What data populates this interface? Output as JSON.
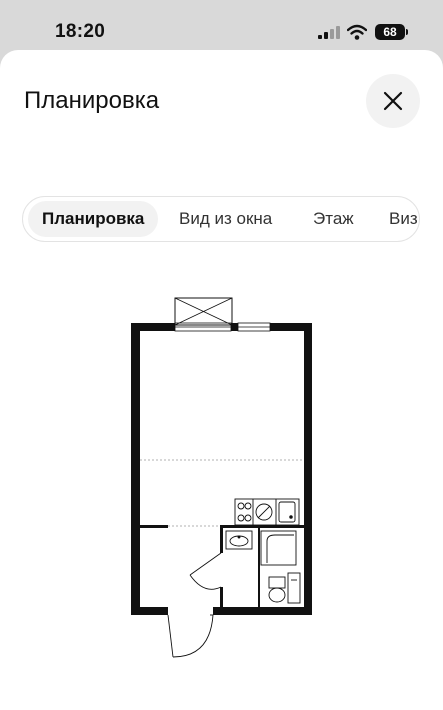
{
  "status_bar": {
    "time": "18:20",
    "battery": "68"
  },
  "sheet": {
    "title": "Планировка",
    "tabs": [
      {
        "label": "Планировка",
        "active": true
      },
      {
        "label": "Вид из окна",
        "active": false
      },
      {
        "label": "Этаж",
        "active": false
      },
      {
        "label": "Виз",
        "active": false
      }
    ]
  },
  "icons": {
    "close": "close-icon",
    "signal": "cellular-signal-icon",
    "wifi": "wifi-icon",
    "battery": "battery-icon"
  },
  "colors": {
    "sheet_bg": "#ffffff",
    "backdrop": "#d9d9d9",
    "active_tab_bg": "#f2f2f2",
    "wall": "#111111"
  }
}
